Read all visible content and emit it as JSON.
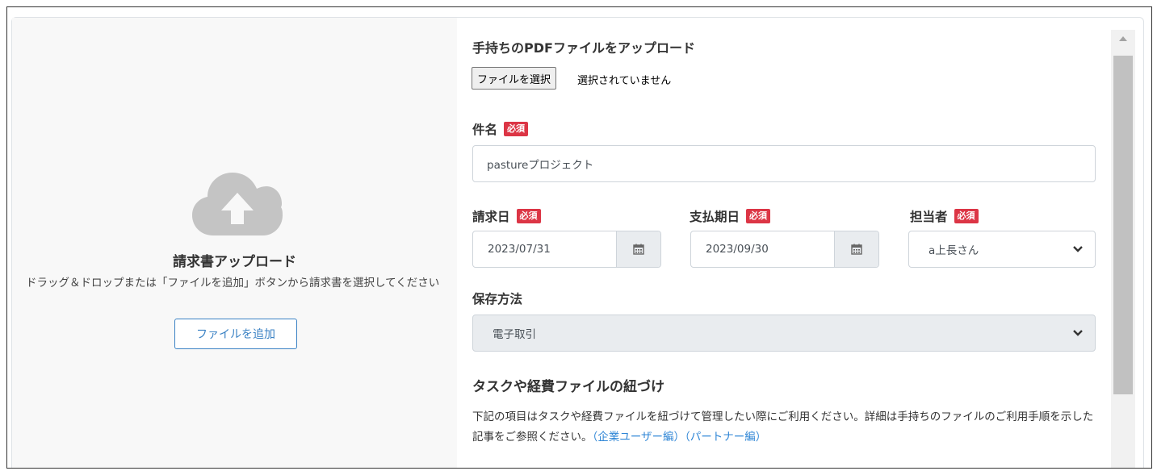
{
  "left": {
    "title": "請求書アップロード",
    "description": "ドラッグ＆ドロップまたは「ファイルを追加」ボタンから請求書を選択してください",
    "add_button": "ファイルを追加",
    "icon": "cloud-upload-icon"
  },
  "form": {
    "pdf_heading": "手持ちのPDFファイルをアップロード",
    "file_button": "ファイルを選択",
    "file_status": "選択されていません",
    "subject_label": "件名",
    "required": "必須",
    "subject_value": "pastureプロジェクト",
    "invoice_date_label": "請求日",
    "invoice_date_value": "2023/07/31",
    "due_date_label": "支払期日",
    "due_date_value": "2023/09/30",
    "assignee_label": "担当者",
    "assignee_value": "a上長さん",
    "storage_label": "保存方法",
    "storage_value": "電子取引",
    "link_heading": "タスクや経費ファイルの紐づけ",
    "link_desc_1": "下記の項目はタスクや経費ファイルを紐づけて管理したい際にご利用ください。詳細は手持ちのファイルのご利用手順を示した記事をご参照ください。",
    "link_corporate": "（企業ユーザー編）",
    "link_partner": "（パートナー編）"
  },
  "colors": {
    "required_badge": "#dc3545",
    "link": "#2f86d6",
    "left_panel_bg": "#f8f8f8",
    "upload_icon": "#c4c4c4"
  }
}
